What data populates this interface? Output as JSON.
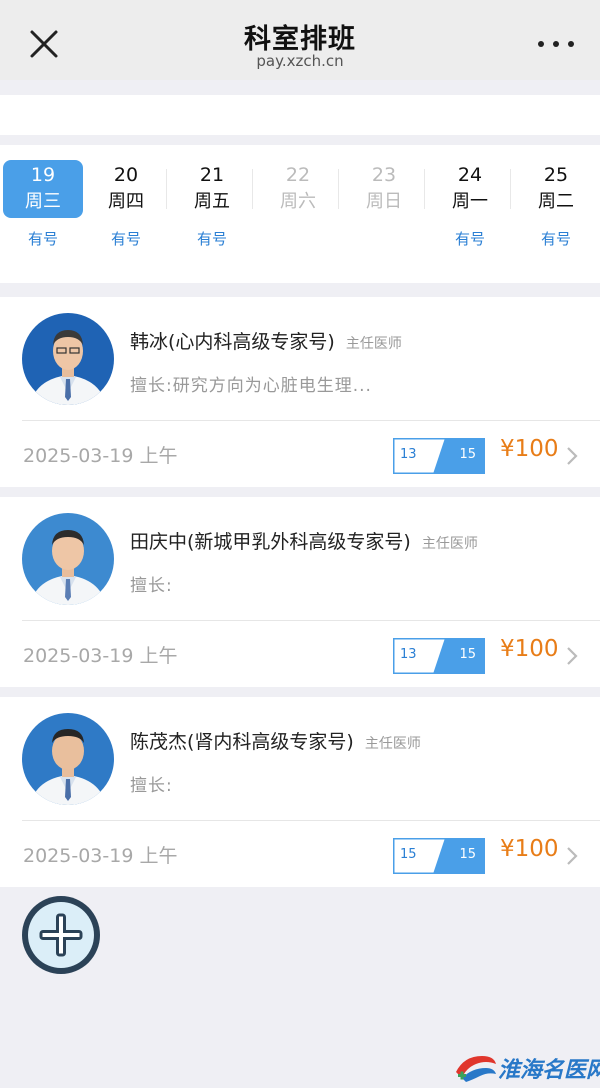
{
  "header": {
    "title": "科室排班",
    "url": "pay.xzch.cn"
  },
  "dates": [
    {
      "day": "19",
      "weekday": "周三",
      "availability": "有号",
      "selected": true,
      "disabled": false
    },
    {
      "day": "20",
      "weekday": "周四",
      "availability": "有号",
      "selected": false,
      "disabled": false
    },
    {
      "day": "21",
      "weekday": "周五",
      "availability": "有号",
      "selected": false,
      "disabled": false
    },
    {
      "day": "22",
      "weekday": "周六",
      "availability": "",
      "selected": false,
      "disabled": true
    },
    {
      "day": "23",
      "weekday": "周日",
      "availability": "",
      "selected": false,
      "disabled": true
    },
    {
      "day": "24",
      "weekday": "周一",
      "availability": "有号",
      "selected": false,
      "disabled": false
    },
    {
      "day": "25",
      "weekday": "周二",
      "availability": "有号",
      "selected": false,
      "disabled": false
    }
  ],
  "doctors": [
    {
      "name": "韩冰(心内科高级专家号)",
      "rank": "主任医师",
      "skill": "擅长:研究方向为心脏电生理...",
      "date": "2025-03-19 上午",
      "quota_left": "13",
      "quota_right": "15",
      "price": "¥100"
    },
    {
      "name": "田庆中(新城甲乳外科高级专家号)",
      "rank": "主任医师",
      "skill": "擅长:",
      "date": "2025-03-19 上午",
      "quota_left": "13",
      "quota_right": "15",
      "price": "¥100"
    },
    {
      "name": "陈茂杰(肾内科高级专家号)",
      "rank": "主任医师",
      "skill": "擅长:",
      "date": "2025-03-19 上午",
      "quota_left": "15",
      "quota_right": "15",
      "price": "¥100"
    }
  ],
  "watermark": {
    "text": "淮海名医网"
  },
  "icons": {
    "close": "close-icon",
    "more": "more-dots-icon",
    "add": "plus-icon",
    "chevron": "chevron-right-icon"
  },
  "colors": {
    "accent": "#4a9fe8",
    "link": "#2a7fd4",
    "price": "#e87d18",
    "fab": "#2b4257"
  }
}
